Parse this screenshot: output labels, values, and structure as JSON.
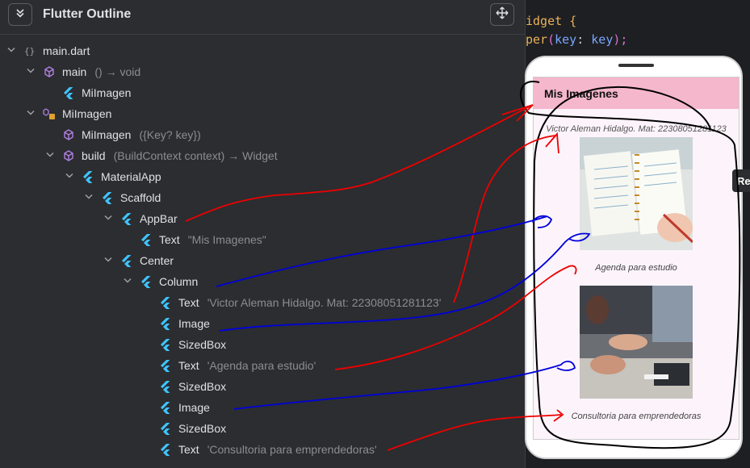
{
  "panel": {
    "title": "Flutter Outline",
    "collapse_icon": "double-chevron-down-icon",
    "move_icon": "move-arrows-icon"
  },
  "tree": [
    {
      "label": "main.dart",
      "detail": "",
      "icon": "braces-icon",
      "indent": 0
    },
    {
      "label": "main",
      "detail": "() → void",
      "icon": "cube-icon",
      "indent": 1
    },
    {
      "label": "MiImagen",
      "detail": "",
      "icon": "flutter-icon",
      "indent": 2
    },
    {
      "label": "MiImagen",
      "detail": "",
      "icon": "class-icon",
      "indent": 1
    },
    {
      "label": "MiImagen",
      "detail": "({Key? key})",
      "icon": "cube-icon",
      "indent": 2
    },
    {
      "label": "build",
      "detail": "(BuildContext context) → Widget",
      "icon": "cube-icon",
      "indent": 2
    },
    {
      "label": "MaterialApp",
      "detail": "",
      "icon": "flutter-icon",
      "indent": 3
    },
    {
      "label": "Scaffold",
      "detail": "",
      "icon": "flutter-icon",
      "indent": 4
    },
    {
      "label": "AppBar",
      "detail": "",
      "icon": "flutter-icon",
      "indent": 5
    },
    {
      "label": "Text",
      "detail": "\"Mis Imagenes\"",
      "icon": "flutter-icon",
      "indent": 6
    },
    {
      "label": "Center",
      "detail": "",
      "icon": "flutter-icon",
      "indent": 5
    },
    {
      "label": "Column",
      "detail": "",
      "icon": "flutter-icon",
      "indent": 6
    },
    {
      "label": "Text",
      "detail": "'Victor Aleman Hidalgo. Mat: 22308051281123'",
      "icon": "flutter-icon",
      "indent": 7
    },
    {
      "label": "Image",
      "detail": "",
      "icon": "flutter-icon",
      "indent": 7
    },
    {
      "label": "SizedBox",
      "detail": "",
      "icon": "flutter-icon",
      "indent": 7
    },
    {
      "label": "Text",
      "detail": "'Agenda para estudio'",
      "icon": "flutter-icon",
      "indent": 7
    },
    {
      "label": "SizedBox",
      "detail": "",
      "icon": "flutter-icon",
      "indent": 7
    },
    {
      "label": "Image",
      "detail": "",
      "icon": "flutter-icon",
      "indent": 7
    },
    {
      "label": "SizedBox",
      "detail": "",
      "icon": "flutter-icon",
      "indent": 7
    },
    {
      "label": "Text",
      "detail": "'Consultoria para emprendedoras'",
      "icon": "flutter-icon",
      "indent": 7
    }
  ],
  "code": {
    "line1_word": "idget",
    "line1_brace": "{",
    "line2_func": "per",
    "line2_paren_open": "(",
    "line2_param": "key",
    "line2_colon": ":",
    "line2_value": "key",
    "line2_close": ");"
  },
  "preview": {
    "appbar_title": "Mis Imagenes",
    "subtitle": "Victor Aleman Hidalgo. Mat: 22308051281123",
    "caption1": "Agenda para estudio",
    "caption2": "Consultoria para emprendedoras",
    "side_tab": "Re"
  },
  "colors": {
    "panel_bg": "#2b2d30",
    "editor_bg": "#1e1f22",
    "appbar": "#f5b7cc",
    "flutter_blue": "#40c4ff",
    "cube_purple": "#b07fe0",
    "annotation_red": "#e00000",
    "annotation_blue": "#0000dd"
  }
}
